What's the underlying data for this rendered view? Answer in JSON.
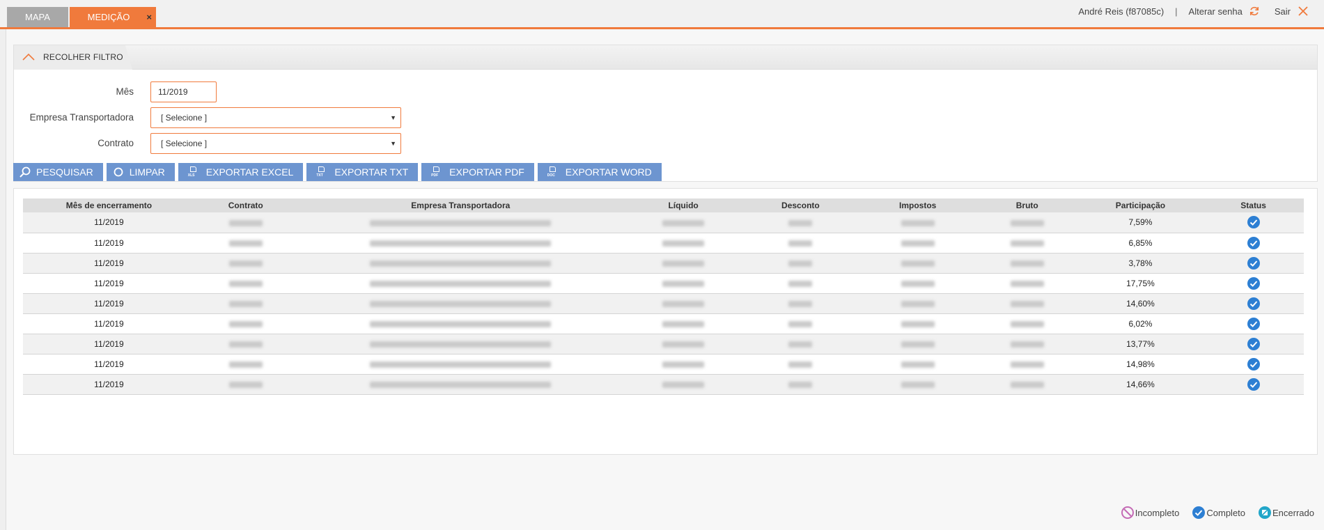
{
  "tabs": [
    {
      "label": "MAPA"
    },
    {
      "label": "MEDIÇÃO",
      "close": "×"
    }
  ],
  "user": {
    "name": "André Reis (f87085c)",
    "separator": "|",
    "change_password": "Alterar senha",
    "logout": "Sair"
  },
  "filter": {
    "title": "RECOLHER FILTRO",
    "fields": {
      "mes": {
        "label": "Mês",
        "value": "11/2019"
      },
      "empresa": {
        "label": "Empresa Transportadora",
        "value": "[ Selecione ]"
      },
      "contrato": {
        "label": "Contrato",
        "value": "[ Selecione ]"
      }
    }
  },
  "buttons": {
    "pesquisar": "PESQUISAR",
    "limpar": "LIMPAR",
    "excel": "EXPORTAR EXCEL",
    "txt": "EXPORTAR TXT",
    "pdf": "EXPORTAR PDF",
    "word": "EXPORTAR WORD"
  },
  "table": {
    "headers": [
      "Mês de encerramento",
      "Contrato",
      "Empresa Transportadora",
      "Líquido",
      "Desconto",
      "Impostos",
      "Bruto",
      "Participação",
      "Status"
    ],
    "rows": [
      {
        "mes": "11/2019",
        "participacao": "7,59%"
      },
      {
        "mes": "11/2019",
        "participacao": "6,85%"
      },
      {
        "mes": "11/2019",
        "participacao": "3,78%"
      },
      {
        "mes": "11/2019",
        "participacao": "17,75%"
      },
      {
        "mes": "11/2019",
        "participacao": "14,60%"
      },
      {
        "mes": "11/2019",
        "participacao": "6,02%"
      },
      {
        "mes": "11/2019",
        "participacao": "13,77%"
      },
      {
        "mes": "11/2019",
        "participacao": "14,98%"
      },
      {
        "mes": "11/2019",
        "participacao": "14,66%"
      }
    ]
  },
  "legend": {
    "incompleto": "Incompleto",
    "completo": "Completo",
    "encerrado": "Encerrado"
  },
  "colors": {
    "accent": "#f07a3c",
    "button": "#6d95d0",
    "status_complete": "#2d7fd3",
    "status_incomplete": "#c46bb5",
    "status_closed": "#22a6c9"
  }
}
